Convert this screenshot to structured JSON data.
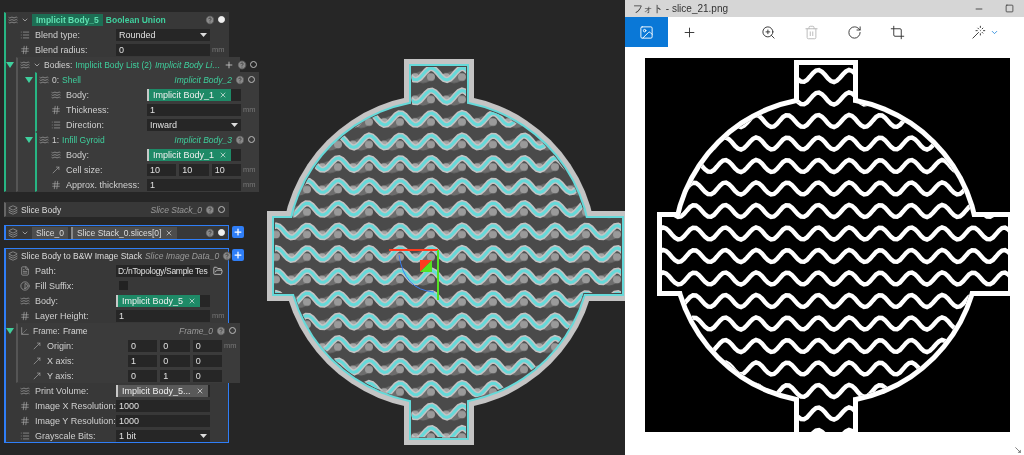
{
  "panel": {
    "nodes": [
      {
        "kind": "boolean",
        "title": "Implicit Body_5",
        "type": "Boolean Union",
        "visible": true,
        "selected": false,
        "rows": [
          {
            "kind": "dropdown",
            "label": "Blend type:",
            "value": "Rounded"
          },
          {
            "kind": "number",
            "label": "Blend radius:",
            "value": "0",
            "unit": "mm"
          },
          {
            "kind": "list",
            "label": "Bodies:",
            "title": "Implicit Body List (2)",
            "output": "Implicit Body Li…",
            "add": true,
            "visible": false,
            "expanded": true,
            "rows": [
              {
                "kind": "body",
                "label": "0:",
                "title": "Shell",
                "output": "Implicit Body_2",
                "visible": false,
                "expanded": true,
                "rows": [
                  {
                    "kind": "chip",
                    "label": "Body:",
                    "value": "Implicit Body_1",
                    "color": "#1e8a67"
                  },
                  {
                    "kind": "number",
                    "label": "Thickness:",
                    "value": "1",
                    "unit": "mm"
                  },
                  {
                    "kind": "dropdown",
                    "label": "Direction:",
                    "value": "Inward"
                  }
                ]
              },
              {
                "kind": "body",
                "label": "1:",
                "title": "Infill Gyroid",
                "output": "Implicit Body_3",
                "visible": false,
                "expanded": true,
                "rows": [
                  {
                    "kind": "chip",
                    "label": "Body:",
                    "value": "Implicit Body_1",
                    "color": "#1e8a67"
                  },
                  {
                    "kind": "vector",
                    "label": "Cell size:",
                    "values": [
                      "10",
                      "10",
                      "10"
                    ],
                    "unit": "mm"
                  },
                  {
                    "kind": "number",
                    "label": "Approx. thickness:",
                    "value": "1",
                    "unit": "mm"
                  }
                ]
              }
            ]
          }
        ]
      },
      {
        "kind": "slice",
        "title": "Slice Body",
        "output": "Slice Stack_0",
        "visible": false,
        "selected": false
      },
      {
        "kind": "variable",
        "title": "Slice_0",
        "chip": "Slice Stack_0.slices[0]",
        "visible": true,
        "selected": true,
        "add": true
      },
      {
        "kind": "export",
        "title": "Slice Body to B&W Image Stack",
        "output": "Slice Image Data_0",
        "selected": true,
        "add": true,
        "rows": [
          {
            "kind": "path",
            "label": "Path:",
            "value": "D:/nTopology/Sample Tes"
          },
          {
            "kind": "checkbox",
            "label": "Fill Suffix:",
            "checked": false
          },
          {
            "kind": "chip",
            "label": "Body:",
            "value": "Implicit Body_5",
            "color": "#1e8a67"
          },
          {
            "kind": "number",
            "label": "Layer Height:",
            "value": "1",
            "unit": "mm"
          },
          {
            "kind": "frame",
            "label": "Frame:",
            "title": "Frame",
            "output": "Frame_0",
            "visible": false,
            "expanded": true,
            "rows": [
              {
                "kind": "vector",
                "label": "Origin:",
                "values": [
                  "0",
                  "0",
                  "0"
                ],
                "unit": "mm"
              },
              {
                "kind": "vector",
                "label": "X axis:",
                "values": [
                  "1",
                  "0",
                  "0"
                ]
              },
              {
                "kind": "vector",
                "label": "Y axis:",
                "values": [
                  "0",
                  "1",
                  "0"
                ]
              }
            ]
          },
          {
            "kind": "chip",
            "label": "Print Volume:",
            "value": "Implicit Body_5...",
            "color": "#595959"
          },
          {
            "kind": "number",
            "label": "Image X Resolution:",
            "value": "1000"
          },
          {
            "kind": "number",
            "label": "Image Y Resolution:",
            "value": "1000"
          },
          {
            "kind": "dropdown",
            "label": "Grayscale Bits:",
            "value": "1 bit"
          }
        ]
      }
    ]
  },
  "photos": {
    "title": "フォト - slice_21.png",
    "toolbar": [
      {
        "kind": "gallery",
        "selected": true,
        "disabled": false
      },
      {
        "kind": "add",
        "selected": false,
        "disabled": false
      },
      {
        "kind": "zoom",
        "selected": false,
        "disabled": false
      },
      {
        "kind": "delete",
        "selected": false,
        "disabled": true
      },
      {
        "kind": "rotate",
        "selected": false,
        "disabled": false
      },
      {
        "kind": "crop",
        "selected": false,
        "disabled": false
      },
      {
        "kind": "enhance",
        "selected": false,
        "disabled": false
      }
    ]
  }
}
